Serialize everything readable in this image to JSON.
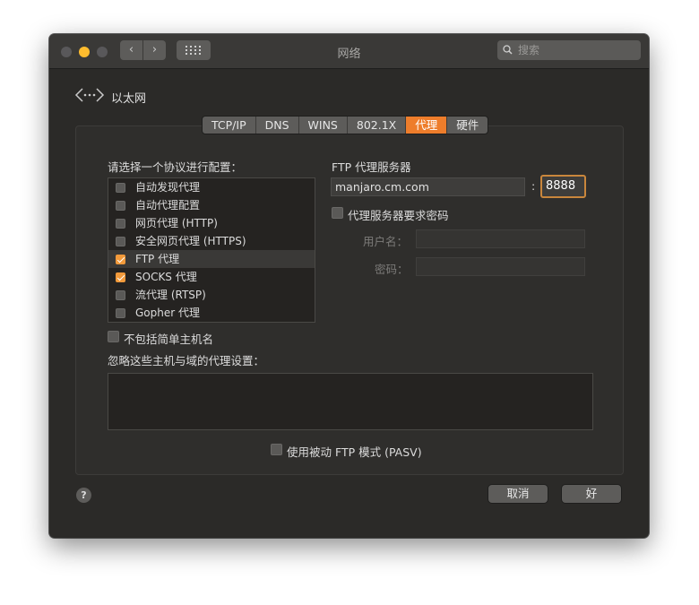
{
  "window": {
    "title": "网络",
    "search_placeholder": "搜索",
    "nav_back_icon": "chevron-left-icon",
    "nav_forward_icon": "chevron-right-icon",
    "grid_icon": "show-all-grid-icon"
  },
  "header": {
    "interface_icon": "ethernet-icon",
    "interface_name": "以太网"
  },
  "tabs": [
    {
      "label": "TCP/IP",
      "active": false
    },
    {
      "label": "DNS",
      "active": false
    },
    {
      "label": "WINS",
      "active": false
    },
    {
      "label": "802.1X",
      "active": false
    },
    {
      "label": "代理",
      "active": true
    },
    {
      "label": "硬件",
      "active": false
    }
  ],
  "protocols": {
    "heading": "请选择一个协议进行配置：",
    "items": [
      {
        "label": "自动发现代理",
        "checked": false,
        "selected": false
      },
      {
        "label": "自动代理配置",
        "checked": false,
        "selected": false
      },
      {
        "label": "网页代理 (HTTP)",
        "checked": false,
        "selected": false
      },
      {
        "label": "安全网页代理 (HTTPS)",
        "checked": false,
        "selected": false
      },
      {
        "label": "FTP 代理",
        "checked": true,
        "selected": true
      },
      {
        "label": "SOCKS 代理",
        "checked": true,
        "selected": false
      },
      {
        "label": "流代理 (RTSP)",
        "checked": false,
        "selected": false
      },
      {
        "label": "Gopher 代理",
        "checked": false,
        "selected": false
      }
    ]
  },
  "ftp": {
    "heading": "FTP 代理服务器",
    "server": "manjaro.cm.com",
    "colon": ":",
    "port": "8888",
    "requires_password_label": "代理服务器要求密码",
    "requires_password": false,
    "username_label": "用户名：",
    "password_label": "密码："
  },
  "exclude_simple": {
    "label": "不包括简单主机名",
    "checked": false
  },
  "bypass": {
    "heading": "忽略这些主机与域的代理设置：",
    "value": ""
  },
  "pasv": {
    "label": "使用被动 FTP 模式 (PASV)",
    "checked": false
  },
  "footer": {
    "cancel": "取消",
    "ok": "好",
    "help": "?"
  },
  "colors": {
    "accent": "#ee7d2b",
    "checkbox_on": "#f29a3b",
    "focus_ring": "#c9863c"
  }
}
